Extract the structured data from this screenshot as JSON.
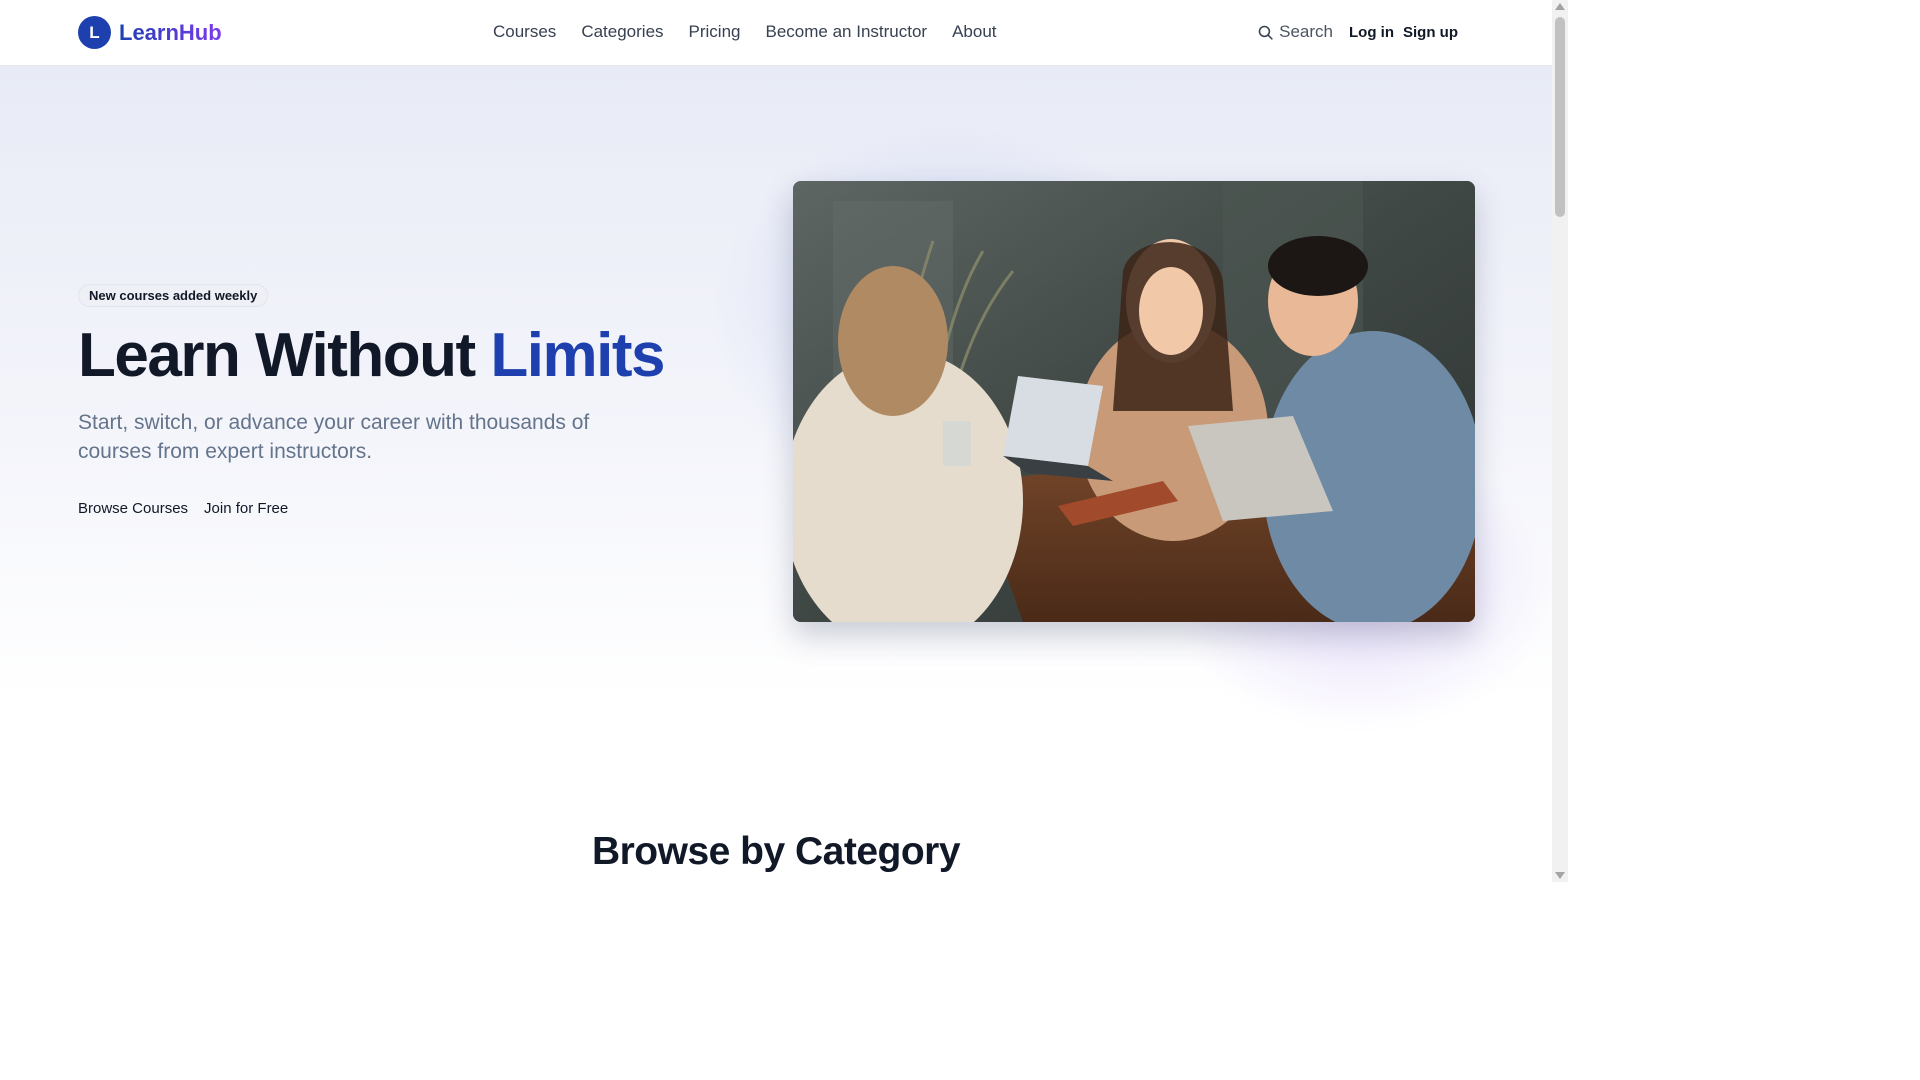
{
  "brand": {
    "initial": "L",
    "name": "LearnHub",
    "colors": {
      "primary": "#1e40af",
      "secondary": "#7c3aed"
    }
  },
  "nav": {
    "items": [
      "Courses",
      "Categories",
      "Pricing",
      "Become an Instructor",
      "About"
    ]
  },
  "header_actions": {
    "search_label": "Search",
    "search_icon": "search-icon",
    "login_label": "Log in",
    "signup_label": "Sign up"
  },
  "hero": {
    "badge": "New courses added weekly",
    "title_main": "Learn Without",
    "title_accent": "Limits",
    "subtitle": "Start, switch, or advance your career with thousands of courses from expert instructors.",
    "primary_cta": "Browse Courses",
    "secondary_cta": "Join for Free"
  },
  "sections": {
    "category_title": "Browse by Category"
  }
}
